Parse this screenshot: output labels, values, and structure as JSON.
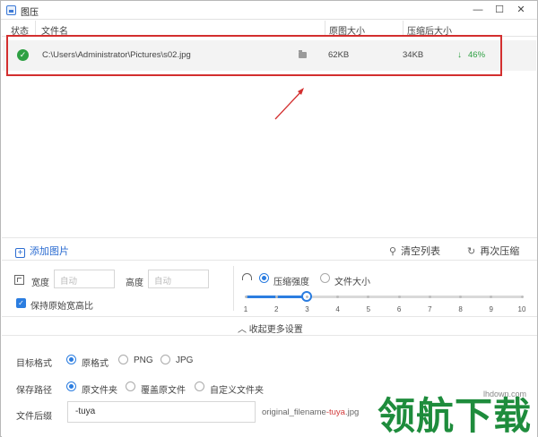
{
  "window": {
    "title": "图压",
    "minimize": "—",
    "maximize": "☐",
    "close": "✕"
  },
  "table": {
    "headers": {
      "status": "状态",
      "filename": "文件名",
      "original_size": "原图大小",
      "compressed_size": "压缩后大小"
    },
    "rows": [
      {
        "status_icon": "check-circle-icon",
        "path": "C:\\Users\\Administrator\\Pictures\\s02.jpg",
        "original": "62KB",
        "compressed": "34KB",
        "ratio": "46%",
        "ratio_arrow": "↓"
      }
    ]
  },
  "toolbar": {
    "add": "添加图片",
    "clear": "清空列表",
    "recompress": "再次压缩"
  },
  "resize": {
    "width_label": "宽度",
    "width_placeholder": "自动",
    "height_label": "高度",
    "height_placeholder": "自动",
    "keep_ratio_label": "保持原始宽高比",
    "keep_ratio_checked": true
  },
  "compress": {
    "mode_quality": "压缩强度",
    "mode_size": "文件大小",
    "selected_mode": "压缩强度",
    "ticks": [
      "1",
      "2",
      "3",
      "4",
      "5",
      "6",
      "7",
      "8",
      "9",
      "10"
    ],
    "value": 3
  },
  "collapse": {
    "label": "收起更多设置"
  },
  "format": {
    "label": "目标格式",
    "options": [
      "原格式",
      "PNG",
      "JPG"
    ],
    "selected": "原格式"
  },
  "save": {
    "label": "保存路径",
    "options": [
      "原文件夹",
      "覆盖原文件",
      "自定义文件夹"
    ],
    "selected": "原文件夹"
  },
  "suffix": {
    "label": "文件后缀",
    "value": "-tuya",
    "preview_prefix": "original_filename",
    "preview_suffix": "-tuya",
    "preview_ext": ".jpg"
  },
  "watermark": {
    "site": "lhdown.com",
    "logo": "领航下载"
  },
  "colors": {
    "accent": "#2b7de0",
    "success": "#2ea043",
    "highlight": "#d32f2f"
  }
}
